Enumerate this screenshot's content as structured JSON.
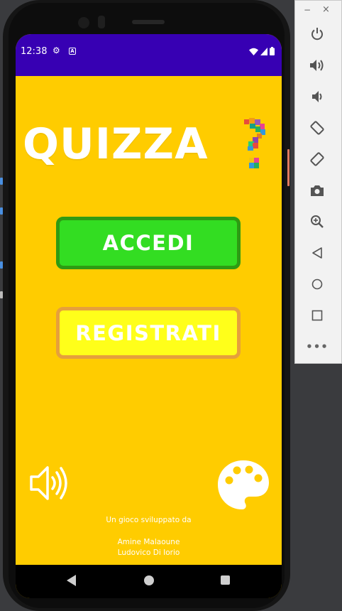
{
  "status_bar": {
    "time": "12:38",
    "icons": [
      "settings-icon",
      "a-badge-icon",
      "wifi-icon",
      "signal-icon",
      "battery-icon"
    ],
    "a_badge_text": "A"
  },
  "app": {
    "title": "QUIZZA",
    "accedi_label": "ACCEDI",
    "registrati_label": "REGISTRATI",
    "credits_line1": "Un gioco sviluppato da",
    "credits_line2": "Amine Malaoune",
    "credits_line3": "Ludovico Di Iorio"
  },
  "colors": {
    "background": "#ffcc00",
    "status_bar": "#3700b3",
    "accedi_fill": "#33dd22",
    "accedi_border": "#2e9b13",
    "registrati_fill": "#ffff1a",
    "registrati_border": "#e6a03c"
  },
  "toolbar": {
    "minimize": "−",
    "close": "×",
    "more": "•••",
    "items": [
      "power-icon",
      "volume-up-icon",
      "volume-down-icon",
      "rotate-left-icon",
      "rotate-right-icon",
      "camera-icon",
      "zoom-icon",
      "back-icon",
      "home-icon",
      "overview-icon",
      "more-icon"
    ]
  }
}
